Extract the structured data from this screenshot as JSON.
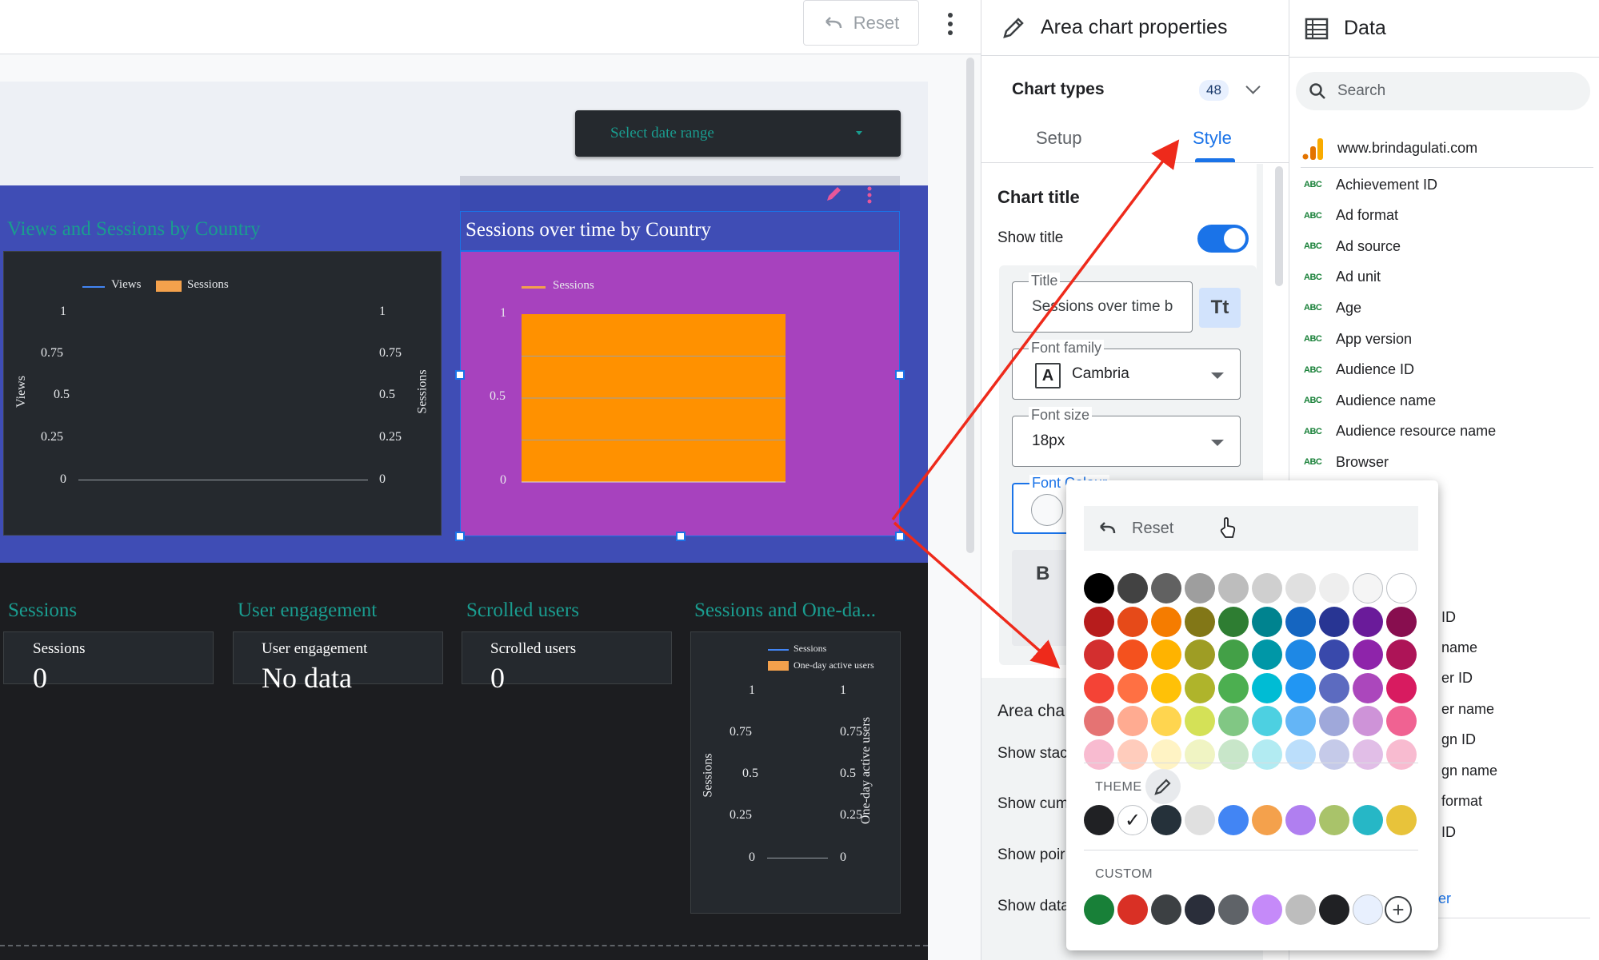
{
  "toolbar": {
    "reset_label": "Reset"
  },
  "header": {
    "date_range_label": "Select date range"
  },
  "charts": {
    "views_sessions": {
      "title": "Views and Sessions by Country",
      "legend": [
        "Views",
        "Sessions"
      ],
      "y_left_label": "Views",
      "y_right_label": "Sessions",
      "ticks_left": [
        "1",
        "0.75",
        "0.5",
        "0.25",
        "0"
      ],
      "ticks_right": [
        "1",
        "0.75",
        "0.5",
        "0.25",
        "0"
      ]
    },
    "sessions_time": {
      "title": "Sessions over time by Country",
      "legend": [
        "Sessions"
      ],
      "ticks": [
        "1",
        "0.5",
        "0"
      ]
    },
    "sessions_oneday": {
      "title": "Sessions and One-da...",
      "legend": [
        "Sessions",
        "One-day active users"
      ],
      "y_left_label": "Sessions",
      "y_right_label": "One-day active users",
      "ticks_left": [
        "1",
        "0.75",
        "0.5",
        "0.25",
        "0"
      ],
      "ticks_right": [
        "1",
        "0.75",
        "0.5",
        "0.25",
        "0"
      ]
    }
  },
  "scorecards": [
    {
      "title": "Sessions",
      "label": "Sessions",
      "value": "0"
    },
    {
      "title": "User engagement",
      "label": "User engagement",
      "value": "No data"
    },
    {
      "title": "Scrolled users",
      "label": "Scrolled users",
      "value": "0"
    }
  ],
  "chart_data": {
    "type": "area",
    "title": "Sessions over time by Country",
    "series": [
      {
        "name": "Sessions",
        "values": [
          1,
          1
        ]
      }
    ],
    "ylim": [
      0,
      1
    ]
  },
  "properties": {
    "title": "Area chart properties",
    "chart_types_label": "Chart types",
    "chart_types_count": "48",
    "tabs": [
      "Setup",
      "Style"
    ],
    "active_tab": "Style",
    "section_chart_title": "Chart title",
    "show_title_label": "Show title",
    "show_title_on": true,
    "title_field_label": "Title",
    "title_field_value": "Sessions over time b",
    "font_family_label": "Font family",
    "font_family_value": "Cambria",
    "font_size_label": "Font size",
    "font_size_value": "18px",
    "font_colour_label": "Font Colour",
    "area_section": "Area cha",
    "rows": [
      "Show stac",
      "Show cum",
      "Show poir",
      "Show data"
    ],
    "partial_b": "B"
  },
  "data_panel": {
    "title": "Data",
    "search_placeholder": "Search",
    "source": "www.brindagulati.com",
    "fields": [
      "Achievement ID",
      "Ad format",
      "Ad source",
      "Ad unit",
      "Age",
      "App version",
      "Audience ID",
      "Audience name",
      "Audience resource name",
      "Browser"
    ],
    "partial_fields": [
      "ID",
      "name",
      "er ID",
      "er name",
      "gn ID",
      "gn name",
      "format",
      "ID"
    ],
    "partial_link": "er",
    "field_type_badge": "ABC"
  },
  "color_picker": {
    "reset_label": "Reset",
    "theme_label": "THEME",
    "custom_label": "CUSTOM",
    "grid_colors": [
      [
        "#000000",
        "#424242",
        "#616161",
        "#9e9e9e",
        "#bdbdbd",
        "#cfcfcf",
        "#e0e0e0",
        "#eeeeee",
        "#f5f5f5",
        "#ffffff"
      ],
      [
        "#b71c1c",
        "#e64a19",
        "#f57c00",
        "#827717",
        "#2e7d32",
        "#00838f",
        "#1565c0",
        "#283593",
        "#6a1b9a",
        "#880e4f"
      ],
      [
        "#d32f2f",
        "#f4511e",
        "#ffb300",
        "#9e9d24",
        "#43a047",
        "#0097a7",
        "#1e88e5",
        "#3949ab",
        "#8e24aa",
        "#ad1457"
      ],
      [
        "#f44336",
        "#ff7043",
        "#ffc107",
        "#afb42b",
        "#4caf50",
        "#00bcd4",
        "#2196f3",
        "#5c6bc0",
        "#ab47bc",
        "#d81b60"
      ],
      [
        "#e57373",
        "#ffab91",
        "#ffd54f",
        "#d4e157",
        "#81c784",
        "#4dd0e1",
        "#64b5f6",
        "#9fa8da",
        "#ce93d8",
        "#f06292"
      ],
      [
        "#f8bbd0",
        "#ffccbc",
        "#fff3c4",
        "#f0f4c3",
        "#c8e6c9",
        "#b2ebf2",
        "#bbdefb",
        "#c5cae9",
        "#e1bee7",
        "#f8bbd0"
      ]
    ],
    "theme_colors": [
      "#202124",
      "#ffffff",
      "#25313a",
      "#e0e0e0",
      "#4285f4",
      "#f4a14c",
      "#b07ff0",
      "#a9c36a",
      "#26b7c6",
      "#e8c33a"
    ],
    "custom_colors": [
      "#188038",
      "#d93025",
      "#3c4043",
      "#2a2e3a",
      "#5f6368",
      "#c58af9",
      "#bdbdbd",
      "#202124",
      "#e8f0fe"
    ]
  }
}
